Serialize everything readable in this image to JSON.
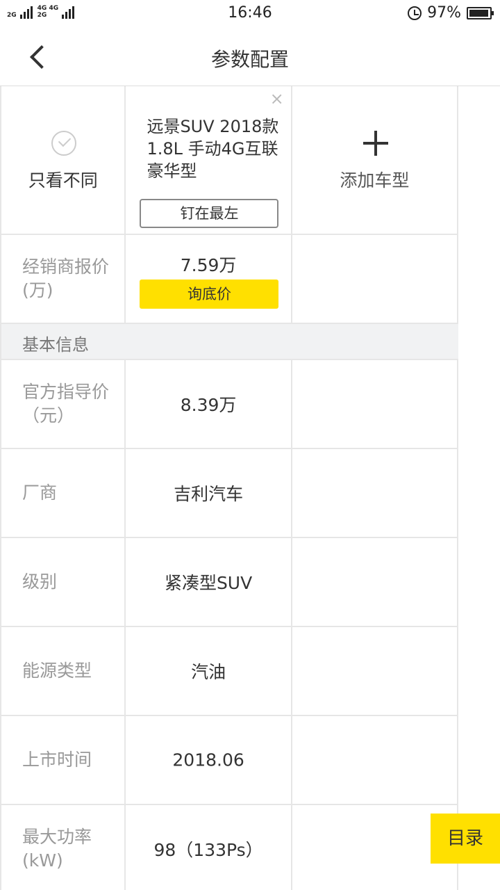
{
  "status_bar": {
    "net_left_top": "2G",
    "net_mid_top": "4G 4G",
    "net_mid_bottom": "2G",
    "time": "16:46",
    "battery_percent": "97%",
    "battery_level": 0.97
  },
  "header": {
    "title": "参数配置"
  },
  "compare_header": {
    "only_diff_label": "只看不同",
    "car_name": "远景SUV 2018款 1.8L 手动4G互联豪华型",
    "close_symbol": "×",
    "pin_label": "钉在最左",
    "add_label": "添加车型"
  },
  "dealer_price": {
    "label": "经销商报价(万)",
    "value": "7.59万",
    "button": "询底价"
  },
  "section_title": "基本信息",
  "rows": [
    {
      "label": "官方指导价（元）",
      "value": "8.39万"
    },
    {
      "label": "厂商",
      "value": "吉利汽车"
    },
    {
      "label": "级别",
      "value": "紧凑型SUV"
    },
    {
      "label": "能源类型",
      "value": "汽油"
    },
    {
      "label": "上市时间",
      "value": "2018.06"
    },
    {
      "label": "最大功率(kW)",
      "value": "98（133Ps）"
    }
  ],
  "toc_button": "目录",
  "colors": {
    "accent": "#ffe000",
    "border": "#e6e6e6",
    "section_bg": "#f1f2f3"
  }
}
